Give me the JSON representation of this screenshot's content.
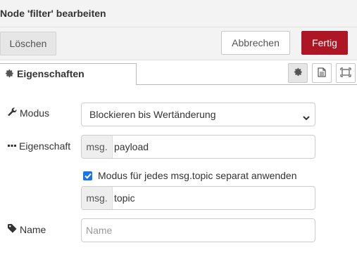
{
  "dialog": {
    "title": "Node 'filter' bearbeiten"
  },
  "toolbar": {
    "delete_label": "Löschen",
    "cancel_label": "Abbrechen",
    "done_label": "Fertig",
    "done_color": "#ad1625"
  },
  "tabs": {
    "active_label": "Eigenschaften",
    "active_icon": "gear-icon",
    "icon_buttons": [
      "gear-icon",
      "description-icon",
      "appearance-icon"
    ]
  },
  "form": {
    "mode": {
      "label": "Modus",
      "icon": "wrench-icon",
      "value": "Blockieren bis Wertänderung"
    },
    "property": {
      "label": "Eigenschaft",
      "icon": "ellipsis-icon",
      "prefix": "msg.",
      "value": "payload"
    },
    "separate_topics": {
      "checked": true,
      "label": "Modus für jedes msg.topic separat anwenden"
    },
    "topic": {
      "prefix": "msg.",
      "value": "topic"
    },
    "name": {
      "label": "Name",
      "icon": "tag-icon",
      "value": "",
      "placeholder": "Name"
    }
  }
}
